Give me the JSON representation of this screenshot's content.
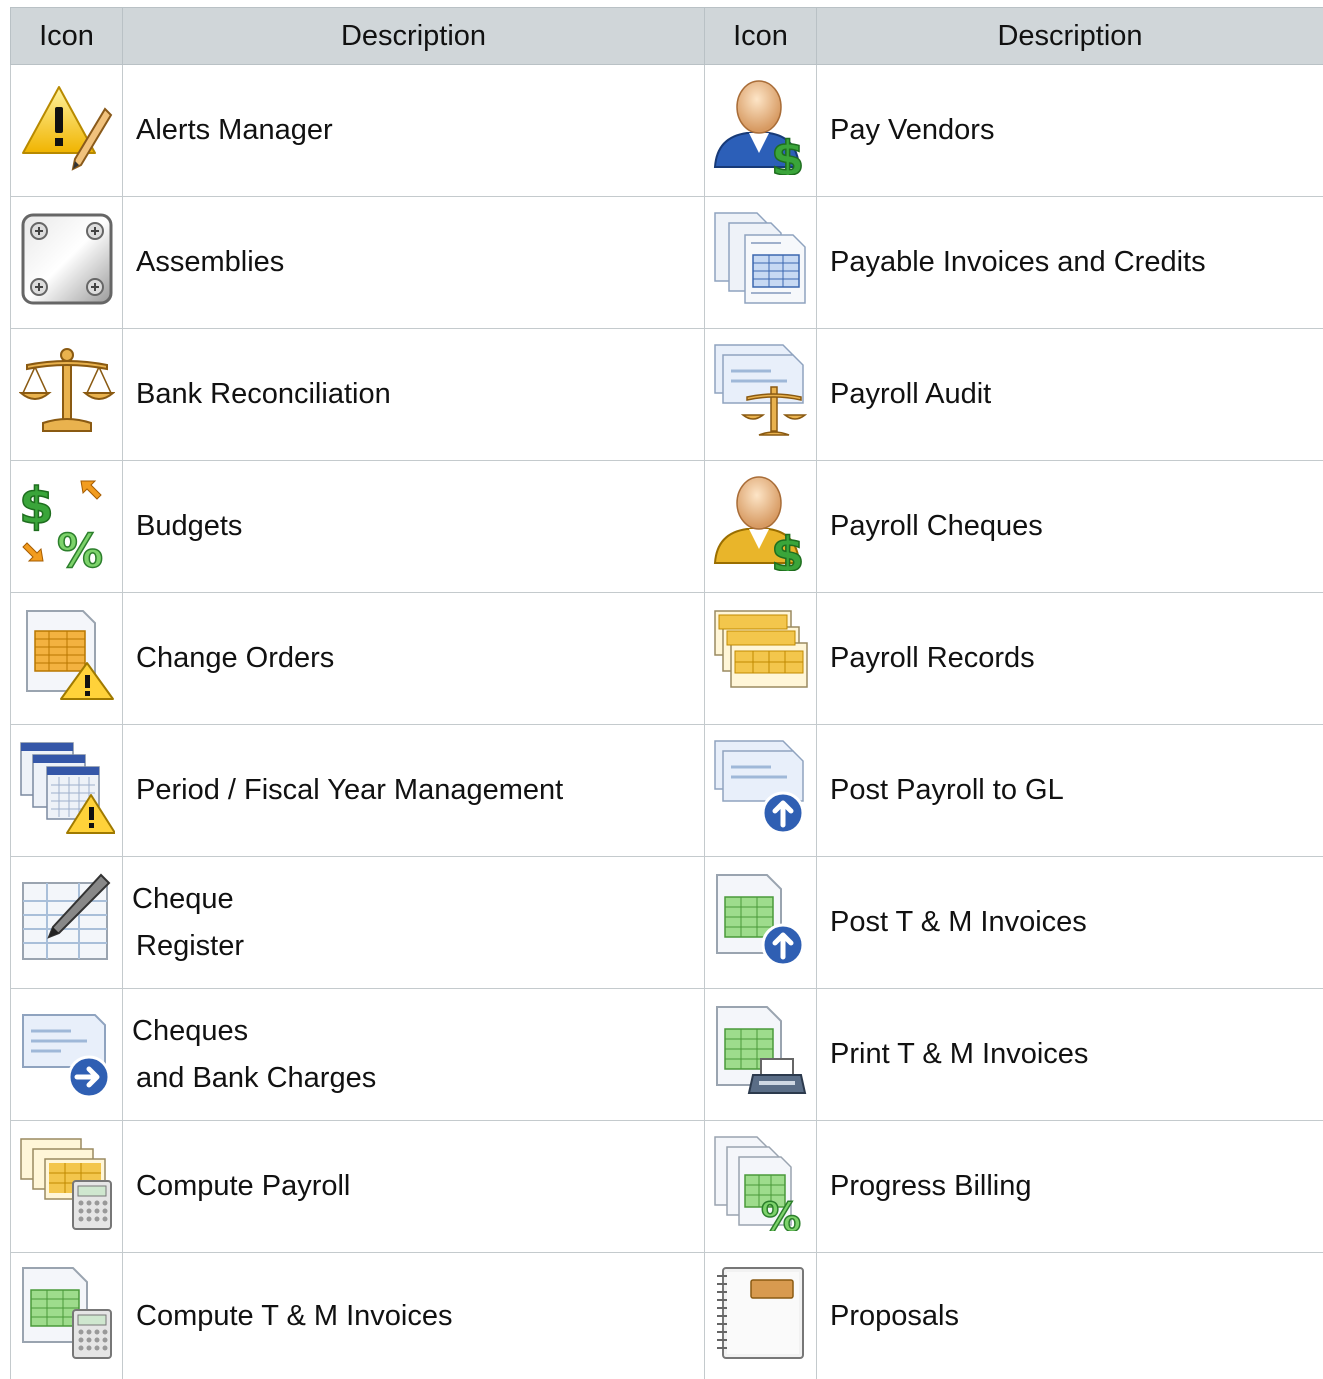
{
  "header": {
    "icon_col": "Icon",
    "desc_col": "Description"
  },
  "left": [
    {
      "icon": "alert-pencil",
      "lines": [
        "Alerts Manager"
      ]
    },
    {
      "icon": "steel-plate",
      "lines": [
        "Assemblies"
      ]
    },
    {
      "icon": "scales",
      "lines": [
        "Bank Reconciliation"
      ]
    },
    {
      "icon": "dollar-percent",
      "lines": [
        "Budgets"
      ]
    },
    {
      "icon": "sheet-warning",
      "lines": [
        "Change Orders"
      ]
    },
    {
      "icon": "calendars-warning",
      "lines": [
        "Period / Fiscal Year Management"
      ]
    },
    {
      "icon": "register-pen",
      "lines": [
        "Cheque",
        "Register"
      ]
    },
    {
      "icon": "cheque-arrow",
      "lines": [
        "Cheques",
        "and Bank Charges"
      ]
    },
    {
      "icon": "payroll-calculator",
      "lines": [
        "Compute Payroll"
      ]
    },
    {
      "icon": "sheet-calculator",
      "lines": [
        "Compute T & M Invoices"
      ]
    }
  ],
  "right": [
    {
      "icon": "person-blue-dollar",
      "lines": [
        "Pay Vendors"
      ]
    },
    {
      "icon": "invoice-stack",
      "lines": [
        "Payable Invoices and Credits"
      ]
    },
    {
      "icon": "cheques-scales",
      "lines": [
        "Payroll Audit"
      ]
    },
    {
      "icon": "person-yellow-dollar",
      "lines": [
        "Payroll Cheques"
      ]
    },
    {
      "icon": "payroll-records",
      "lines": [
        "Payroll Records"
      ]
    },
    {
      "icon": "cheques-upload",
      "lines": [
        "Post Payroll to GL"
      ]
    },
    {
      "icon": "sheet-upload",
      "lines": [
        "Post T & M Invoices"
      ]
    },
    {
      "icon": "sheet-printer",
      "lines": [
        "Print T & M Invoices"
      ]
    },
    {
      "icon": "sheets-percent",
      "lines": [
        "Progress Billing"
      ]
    },
    {
      "icon": "notebook",
      "lines": [
        "Proposals"
      ]
    }
  ]
}
